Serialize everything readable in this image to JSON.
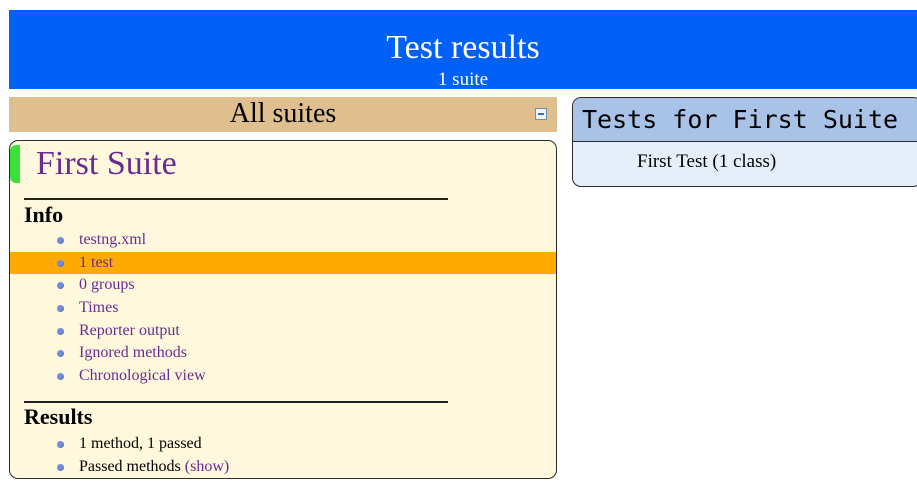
{
  "header": {
    "title": "Test results",
    "subtitle": "1 suite"
  },
  "navigator": {
    "title": "All suites",
    "collapse_icon": "collapse-minus-icon"
  },
  "suite": {
    "name": "First Suite",
    "info": {
      "heading": "Info",
      "items": [
        {
          "label": "testng.xml",
          "selected": false
        },
        {
          "label": "1 test",
          "selected": true
        },
        {
          "label": "0 groups",
          "selected": false
        },
        {
          "label": "Times",
          "selected": false
        },
        {
          "label": "Reporter output",
          "selected": false
        },
        {
          "label": "Ignored methods",
          "selected": false
        },
        {
          "label": "Chronological view",
          "selected": false
        }
      ]
    },
    "results": {
      "heading": "Results",
      "summary": "1 method, 1 passed",
      "passed_label": "Passed methods",
      "show_link": "(show)"
    }
  },
  "tests_panel": {
    "header": "Tests for First Suite",
    "rows": [
      "First Test (1 class)"
    ]
  },
  "colors": {
    "banner": "#0060f8",
    "navigator_bg": "#dfbf8e",
    "suite_bg": "#fff8dc",
    "suite_marker": "#38e238",
    "selected_row": "#ffaa00",
    "link": "#6a2c91",
    "tests_header_bg": "#a9c3e6",
    "tests_body_bg": "#e5eef9"
  }
}
